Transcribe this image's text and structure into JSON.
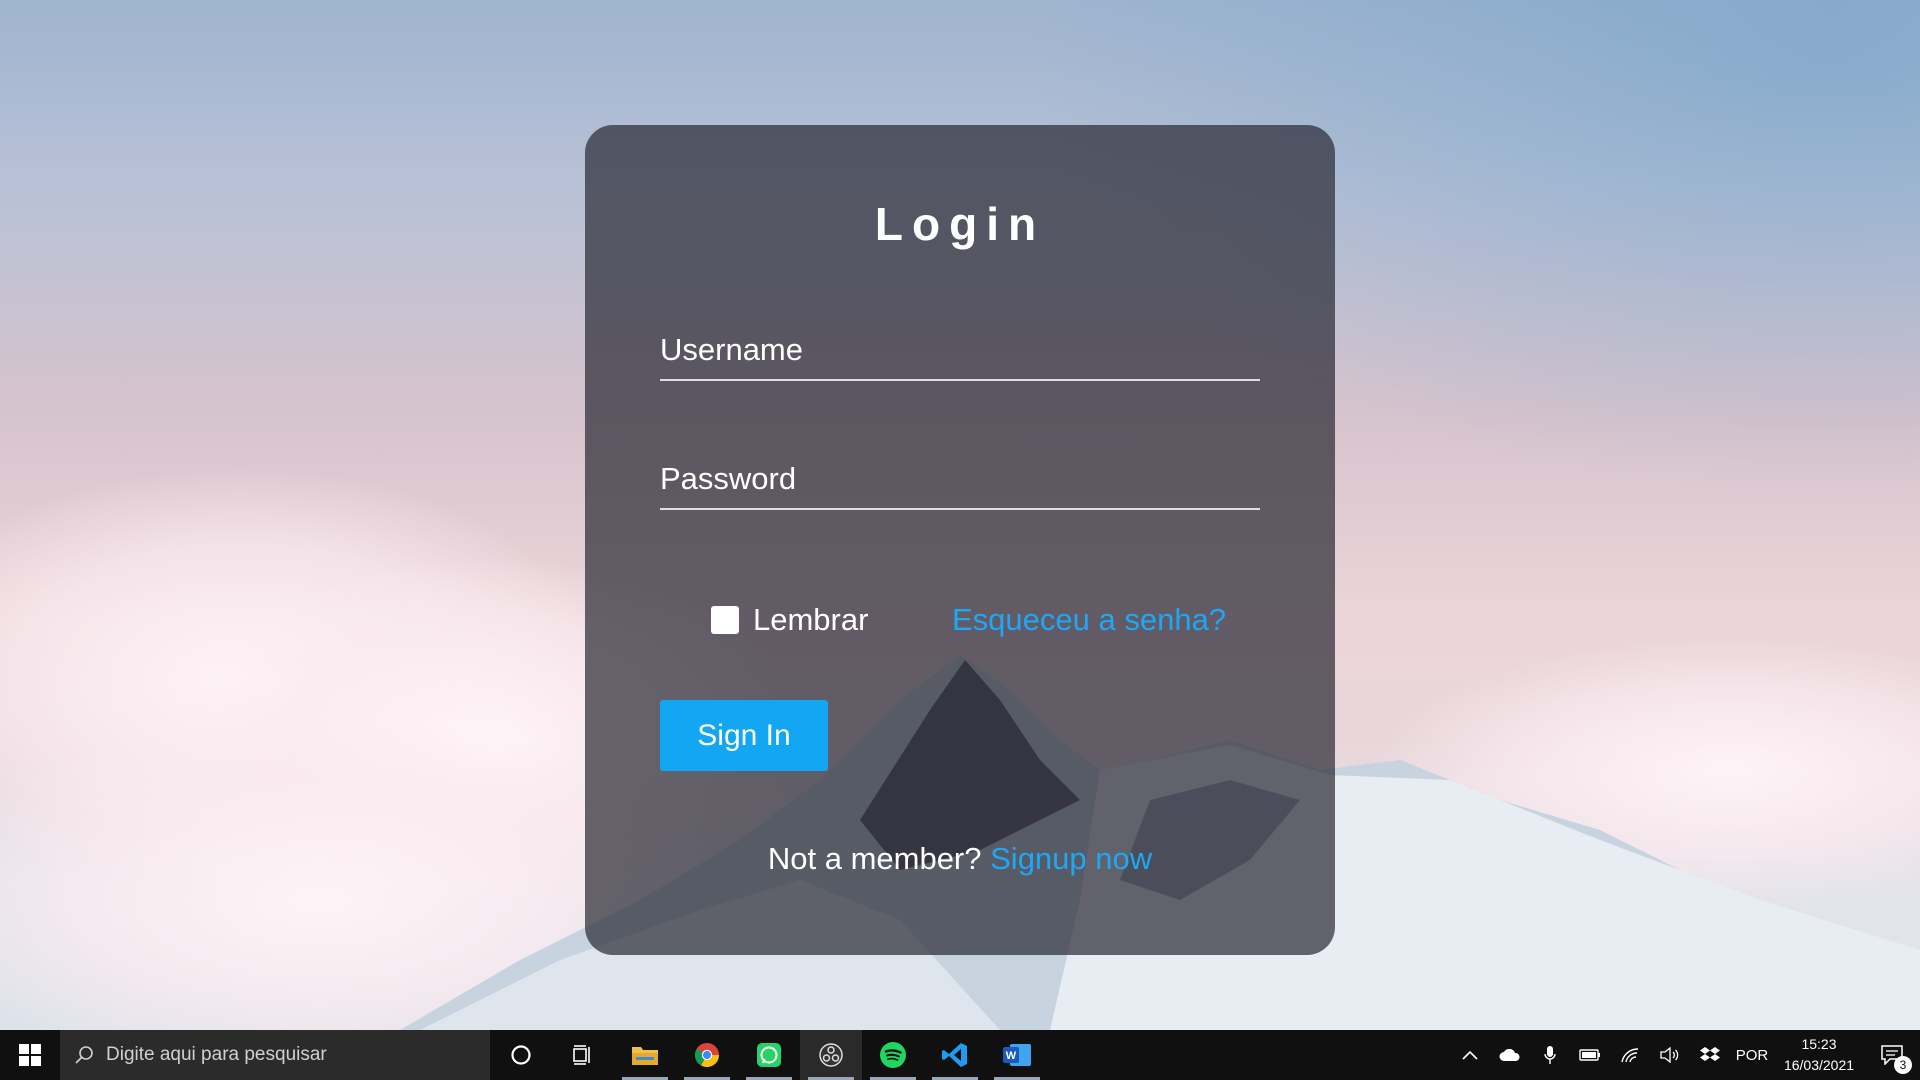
{
  "login": {
    "title": "Login",
    "username_placeholder": "Username",
    "password_placeholder": "Password",
    "remember_label": "Lembrar",
    "remember_checked": false,
    "forgot_link": "Esqueceu a senha?",
    "signin_button": "Sign In",
    "not_member_text": "Not a member?",
    "signup_link": "Signup now"
  },
  "colors": {
    "accent": "#12a6f3",
    "link": "#1ea7f5",
    "card": "#2d2d37",
    "taskbar": "#101010"
  },
  "taskbar": {
    "search_placeholder": "Digite aqui para pesquisar",
    "apps": [
      "cortana-icon",
      "task-view-icon",
      "file-explorer-icon",
      "chrome-icon",
      "whatsapp-icon",
      "obs-icon",
      "spotify-icon",
      "vscode-icon",
      "word-icon"
    ],
    "tray": {
      "language": "POR",
      "time": "15:23",
      "date": "16/03/2021",
      "notification_count": "3"
    }
  }
}
